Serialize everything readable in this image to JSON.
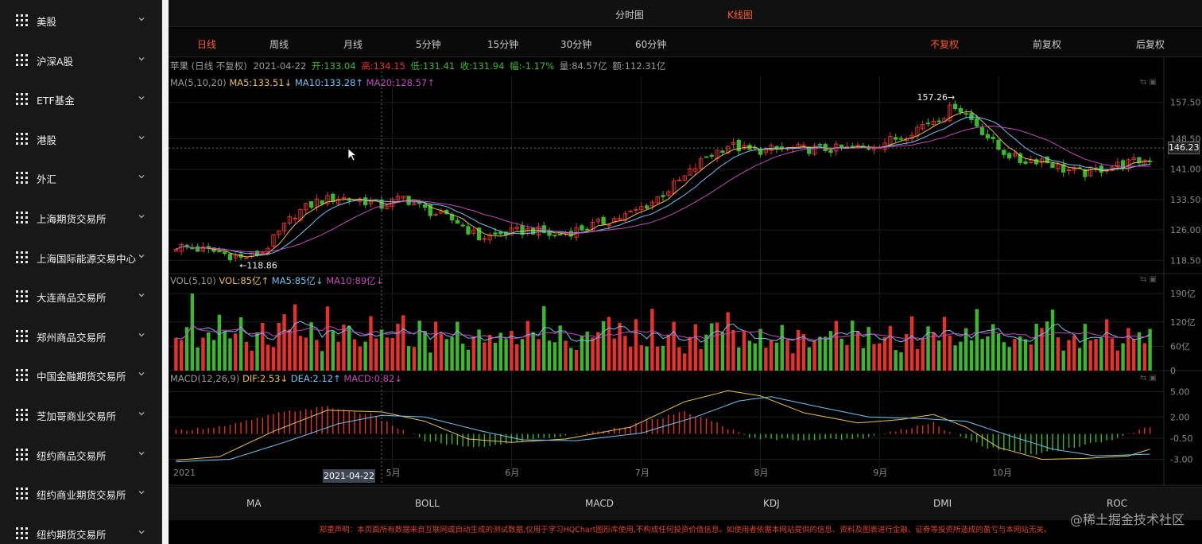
{
  "sidebar": {
    "items": [
      {
        "label": "美股"
      },
      {
        "label": "沪深A股"
      },
      {
        "label": "ETF基金"
      },
      {
        "label": "港股"
      },
      {
        "label": "外汇"
      },
      {
        "label": "上海期货交易所"
      },
      {
        "label": "上海国际能源交易中心"
      },
      {
        "label": "大连商品交易所"
      },
      {
        "label": "郑州商品交易所"
      },
      {
        "label": "中国金融期货交易所"
      },
      {
        "label": "芝加哥商业交易所"
      },
      {
        "label": "纽约商品交易所"
      },
      {
        "label": "纽约商业期货交易所"
      },
      {
        "label": "纽约期货交易所"
      }
    ]
  },
  "top_tabs": [
    {
      "label": "分时图",
      "active": false
    },
    {
      "label": "K线图",
      "active": true
    }
  ],
  "period_tabs": [
    {
      "label": "日线",
      "active": true
    },
    {
      "label": "周线",
      "active": false
    },
    {
      "label": "月线",
      "active": false
    },
    {
      "label": "5分钟",
      "active": false
    },
    {
      "label": "15分钟",
      "active": false
    },
    {
      "label": "30分钟",
      "active": false
    },
    {
      "label": "60分钟",
      "active": false
    }
  ],
  "adjust_tabs": [
    {
      "label": "不复权",
      "active": true
    },
    {
      "label": "前复权",
      "active": false
    },
    {
      "label": "后复权",
      "active": false
    }
  ],
  "info": {
    "name": "苹果",
    "period": "(日线 不复权)",
    "date": "2021-04-22",
    "open": "开:133.04",
    "high": "高:134.15",
    "low": "低:131.41",
    "close": "收:131.94",
    "change": "幅:-1.17%",
    "volume": "量:84.57亿",
    "amount": "额:112.31亿"
  },
  "ma_line": {
    "title": "MA(5,10,20)",
    "ma5": "MA5:133.51↓",
    "ma10": "MA10:133.28↑",
    "ma20": "MA20:128.57↑"
  },
  "vol_line": {
    "title": "VOL(5,10)",
    "vol": "VOL:85亿↑",
    "ma5": "MA5:85亿↓",
    "ma10": "MA10:89亿↓"
  },
  "macd_line": {
    "title": "MACD(12,26,9)",
    "dif": "DIF:2.53↓",
    "dea": "DEA:2.12↑",
    "macd": "MACD:0.82↓"
  },
  "cursor": {
    "date_tag": "2021-04-22",
    "price_tag": "146.23"
  },
  "bottom_indicators": [
    "MA",
    "BOLL",
    "MACD",
    "KDJ",
    "DMI",
    "ROC"
  ],
  "disclaimer": "郑重声明：本页面所有数据来自互联网或自动生成的测试数据,仅用于学习HQChart图形库使用,不构成任何投资价值信息。如使用者依据本网站提供的信息、资料及图表进行金融、证券等投资所造成的盈亏与本网站无关。",
  "watermark": "@稀土掘金技术社区",
  "colors": {
    "up": "#e8312a",
    "down": "#3cb82e",
    "ma5": "#e6c14a",
    "ma10": "#6ec3f0",
    "ma20": "#c04ab8",
    "accent": "#ff5a2a"
  },
  "chart_data": {
    "type": "candlestick",
    "price_axis": {
      "ticks": [
        "157.50",
        "148.50",
        "141.00",
        "133.50",
        "126.00",
        "118.50"
      ],
      "range": [
        116,
        160
      ]
    },
    "max_label": "157.26→",
    "min_label": "←118.86",
    "volume_axis": {
      "ticks": [
        "190亿",
        "120亿",
        "60亿",
        "0"
      ],
      "range": [
        0,
        200
      ]
    },
    "macd_axis": {
      "ticks": [
        "5.00",
        "2.00",
        "-0.50",
        "-3.00"
      ],
      "range": [
        -3.8,
        5.6
      ]
    },
    "x_labels": [
      "2021",
      "5月",
      "6月",
      "7月",
      "8月",
      "9月",
      "10月"
    ],
    "x_label_index": [
      0,
      40,
      62,
      86,
      108,
      130,
      152
    ],
    "close_path": [
      [
        0,
        122
      ],
      [
        8,
        120.5
      ],
      [
        12,
        119
      ],
      [
        16,
        120.5
      ],
      [
        22,
        130
      ],
      [
        26,
        133
      ],
      [
        30,
        134
      ],
      [
        34,
        133.5
      ],
      [
        38,
        131.94
      ],
      [
        42,
        134
      ],
      [
        46,
        131
      ],
      [
        52,
        128
      ],
      [
        56,
        124
      ],
      [
        62,
        125.5
      ],
      [
        66,
        126
      ],
      [
        70,
        124.5
      ],
      [
        74,
        126
      ],
      [
        78,
        127.5
      ],
      [
        84,
        130
      ],
      [
        88,
        133
      ],
      [
        94,
        139
      ],
      [
        98,
        144
      ],
      [
        102,
        147
      ],
      [
        106,
        145.5
      ],
      [
        112,
        146
      ],
      [
        118,
        146
      ],
      [
        124,
        146
      ],
      [
        128,
        146.5
      ],
      [
        134,
        149
      ],
      [
        138,
        152
      ],
      [
        142,
        154.5
      ],
      [
        144,
        157
      ],
      [
        148,
        152
      ],
      [
        152,
        146
      ],
      [
        156,
        143
      ],
      [
        160,
        143.5
      ],
      [
        164,
        141
      ],
      [
        168,
        140
      ],
      [
        172,
        141.5
      ],
      [
        176,
        142.5
      ],
      [
        180,
        143.5
      ]
    ],
    "volume_pattern": [
      110,
      95,
      140,
      80,
      70,
      100,
      85,
      60,
      125,
      75,
      65,
      90,
      105,
      70,
      55,
      85,
      115,
      65,
      80,
      95
    ],
    "hist_path": [
      [
        0,
        0.4
      ],
      [
        10,
        1.0
      ],
      [
        20,
        2.6
      ],
      [
        28,
        3.2
      ],
      [
        36,
        2.3
      ],
      [
        42,
        0.4
      ],
      [
        46,
        -0.8
      ],
      [
        54,
        -1.6
      ],
      [
        60,
        -1.3
      ],
      [
        66,
        -0.6
      ],
      [
        72,
        -0.2
      ],
      [
        78,
        0.3
      ],
      [
        86,
        1.3
      ],
      [
        94,
        2.6
      ],
      [
        100,
        1.3
      ],
      [
        106,
        -0.5
      ],
      [
        112,
        -0.6
      ],
      [
        120,
        -0.7
      ],
      [
        128,
        -0.4
      ],
      [
        136,
        0.8
      ],
      [
        140,
        1.4
      ],
      [
        142,
        0.4
      ],
      [
        150,
        -1.6
      ],
      [
        158,
        -2.4
      ],
      [
        166,
        -1.6
      ],
      [
        174,
        -0.5
      ],
      [
        180,
        0.9
      ]
    ],
    "dif_path": [
      [
        0,
        -3.1
      ],
      [
        8,
        -2.7
      ],
      [
        18,
        0.3
      ],
      [
        28,
        2.8
      ],
      [
        38,
        2.6
      ],
      [
        46,
        1.5
      ],
      [
        54,
        -0.6
      ],
      [
        62,
        -1.0
      ],
      [
        72,
        -0.6
      ],
      [
        84,
        0.8
      ],
      [
        94,
        3.8
      ],
      [
        102,
        5.1
      ],
      [
        108,
        4.5
      ],
      [
        116,
        2.5
      ],
      [
        126,
        1.3
      ],
      [
        134,
        1.7
      ],
      [
        140,
        2.3
      ],
      [
        146,
        0.8
      ],
      [
        152,
        -1.6
      ],
      [
        160,
        -3.0
      ],
      [
        168,
        -2.9
      ],
      [
        176,
        -2.6
      ],
      [
        180,
        -1.8
      ]
    ],
    "dea_path": [
      [
        0,
        -3.3
      ],
      [
        10,
        -3.0
      ],
      [
        20,
        -1.0
      ],
      [
        30,
        1.2
      ],
      [
        38,
        2.2
      ],
      [
        46,
        2.0
      ],
      [
        56,
        0.4
      ],
      [
        64,
        -0.7
      ],
      [
        74,
        -0.8
      ],
      [
        86,
        0.1
      ],
      [
        96,
        2.0
      ],
      [
        104,
        3.9
      ],
      [
        110,
        4.4
      ],
      [
        118,
        3.3
      ],
      [
        128,
        2.0
      ],
      [
        138,
        1.8
      ],
      [
        146,
        1.5
      ],
      [
        154,
        -0.2
      ],
      [
        162,
        -1.8
      ],
      [
        170,
        -2.6
      ],
      [
        180,
        -2.4
      ]
    ]
  }
}
